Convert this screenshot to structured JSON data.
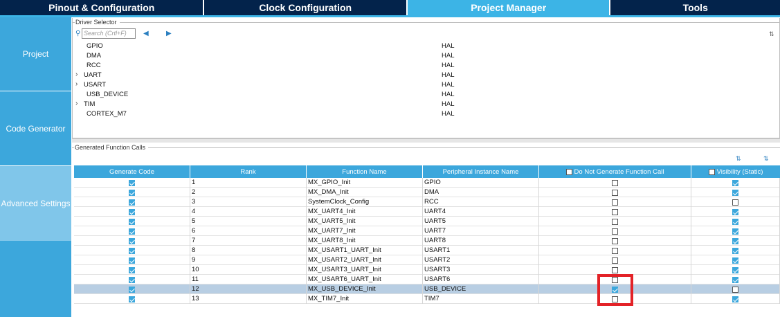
{
  "top_tabs": [
    {
      "label": "Pinout & Configuration",
      "active": false
    },
    {
      "label": "Clock Configuration",
      "active": false
    },
    {
      "label": "Project Manager",
      "active": true
    },
    {
      "label": "Tools",
      "active": false
    }
  ],
  "left_nav": [
    {
      "label": "Project",
      "active": false
    },
    {
      "label": "Code Generator",
      "active": false
    },
    {
      "label": "Advanced Settings",
      "active": true
    }
  ],
  "driver_selector": {
    "title": "Driver Selector",
    "search_placeholder": "Search (Crtl+F)",
    "rows": [
      {
        "name": "GPIO",
        "value": "HAL",
        "expandable": false
      },
      {
        "name": "DMA",
        "value": "HAL",
        "expandable": false
      },
      {
        "name": "RCC",
        "value": "HAL",
        "expandable": false
      },
      {
        "name": "UART",
        "value": "HAL",
        "expandable": true
      },
      {
        "name": "USART",
        "value": "HAL",
        "expandable": true
      },
      {
        "name": "USB_DEVICE",
        "value": "HAL",
        "expandable": false
      },
      {
        "name": "TIM",
        "value": "HAL",
        "expandable": true
      },
      {
        "name": "CORTEX_M7",
        "value": "HAL",
        "expandable": false
      }
    ]
  },
  "generated_calls": {
    "title": "Generated Function Calls",
    "headers": {
      "generate_code": "Generate Code",
      "rank": "Rank",
      "function_name": "Function Name",
      "peripheral": "Peripheral Instance Name",
      "do_not_generate": "Do Not Generate Function Call",
      "visibility": "Visibility (Static)"
    },
    "rows": [
      {
        "generate": true,
        "rank": "1",
        "function": "MX_GPIO_Init",
        "peripheral": "GPIO",
        "do_not_generate": false,
        "visibility": true,
        "selected": false
      },
      {
        "generate": true,
        "rank": "2",
        "function": "MX_DMA_Init",
        "peripheral": "DMA",
        "do_not_generate": false,
        "visibility": true,
        "selected": false
      },
      {
        "generate": true,
        "rank": "3",
        "function": "SystemClock_Config",
        "peripheral": "RCC",
        "do_not_generate": false,
        "visibility": false,
        "selected": false
      },
      {
        "generate": true,
        "rank": "4",
        "function": "MX_UART4_Init",
        "peripheral": "UART4",
        "do_not_generate": false,
        "visibility": true,
        "selected": false
      },
      {
        "generate": true,
        "rank": "5",
        "function": "MX_UART5_Init",
        "peripheral": "UART5",
        "do_not_generate": false,
        "visibility": true,
        "selected": false
      },
      {
        "generate": true,
        "rank": "6",
        "function": "MX_UART7_Init",
        "peripheral": "UART7",
        "do_not_generate": false,
        "visibility": true,
        "selected": false
      },
      {
        "generate": true,
        "rank": "7",
        "function": "MX_UART8_Init",
        "peripheral": "UART8",
        "do_not_generate": false,
        "visibility": true,
        "selected": false
      },
      {
        "generate": true,
        "rank": "8",
        "function": "MX_USART1_UART_Init",
        "peripheral": "USART1",
        "do_not_generate": false,
        "visibility": true,
        "selected": false
      },
      {
        "generate": true,
        "rank": "9",
        "function": "MX_USART2_UART_Init",
        "peripheral": "USART2",
        "do_not_generate": false,
        "visibility": true,
        "selected": false
      },
      {
        "generate": true,
        "rank": "10",
        "function": "MX_USART3_UART_Init",
        "peripheral": "USART3",
        "do_not_generate": false,
        "visibility": true,
        "selected": false
      },
      {
        "generate": true,
        "rank": "11",
        "function": "MX_USART6_UART_Init",
        "peripheral": "USART6",
        "do_not_generate": false,
        "visibility": true,
        "selected": false
      },
      {
        "generate": true,
        "rank": "12",
        "function": "MX_USB_DEVICE_Init",
        "peripheral": "USB_DEVICE",
        "do_not_generate": true,
        "visibility": false,
        "selected": true
      },
      {
        "generate": true,
        "rank": "13",
        "function": "MX_TIM7_Init",
        "peripheral": "TIM7",
        "do_not_generate": false,
        "visibility": true,
        "selected": false
      }
    ]
  },
  "colors": {
    "dark_navy": "#03234b",
    "accent_blue": "#3cb4e6",
    "table_header": "#3ca7dc",
    "selected_row": "#b8cee3",
    "annotation_red": "#e32227"
  },
  "icons": {
    "search": "search-icon",
    "collapse": "collapse-all-icon",
    "expand": "expand-all-icon",
    "sort": "sort-icon",
    "move_up": "move-up-icon",
    "move_down": "move-down-icon"
  }
}
